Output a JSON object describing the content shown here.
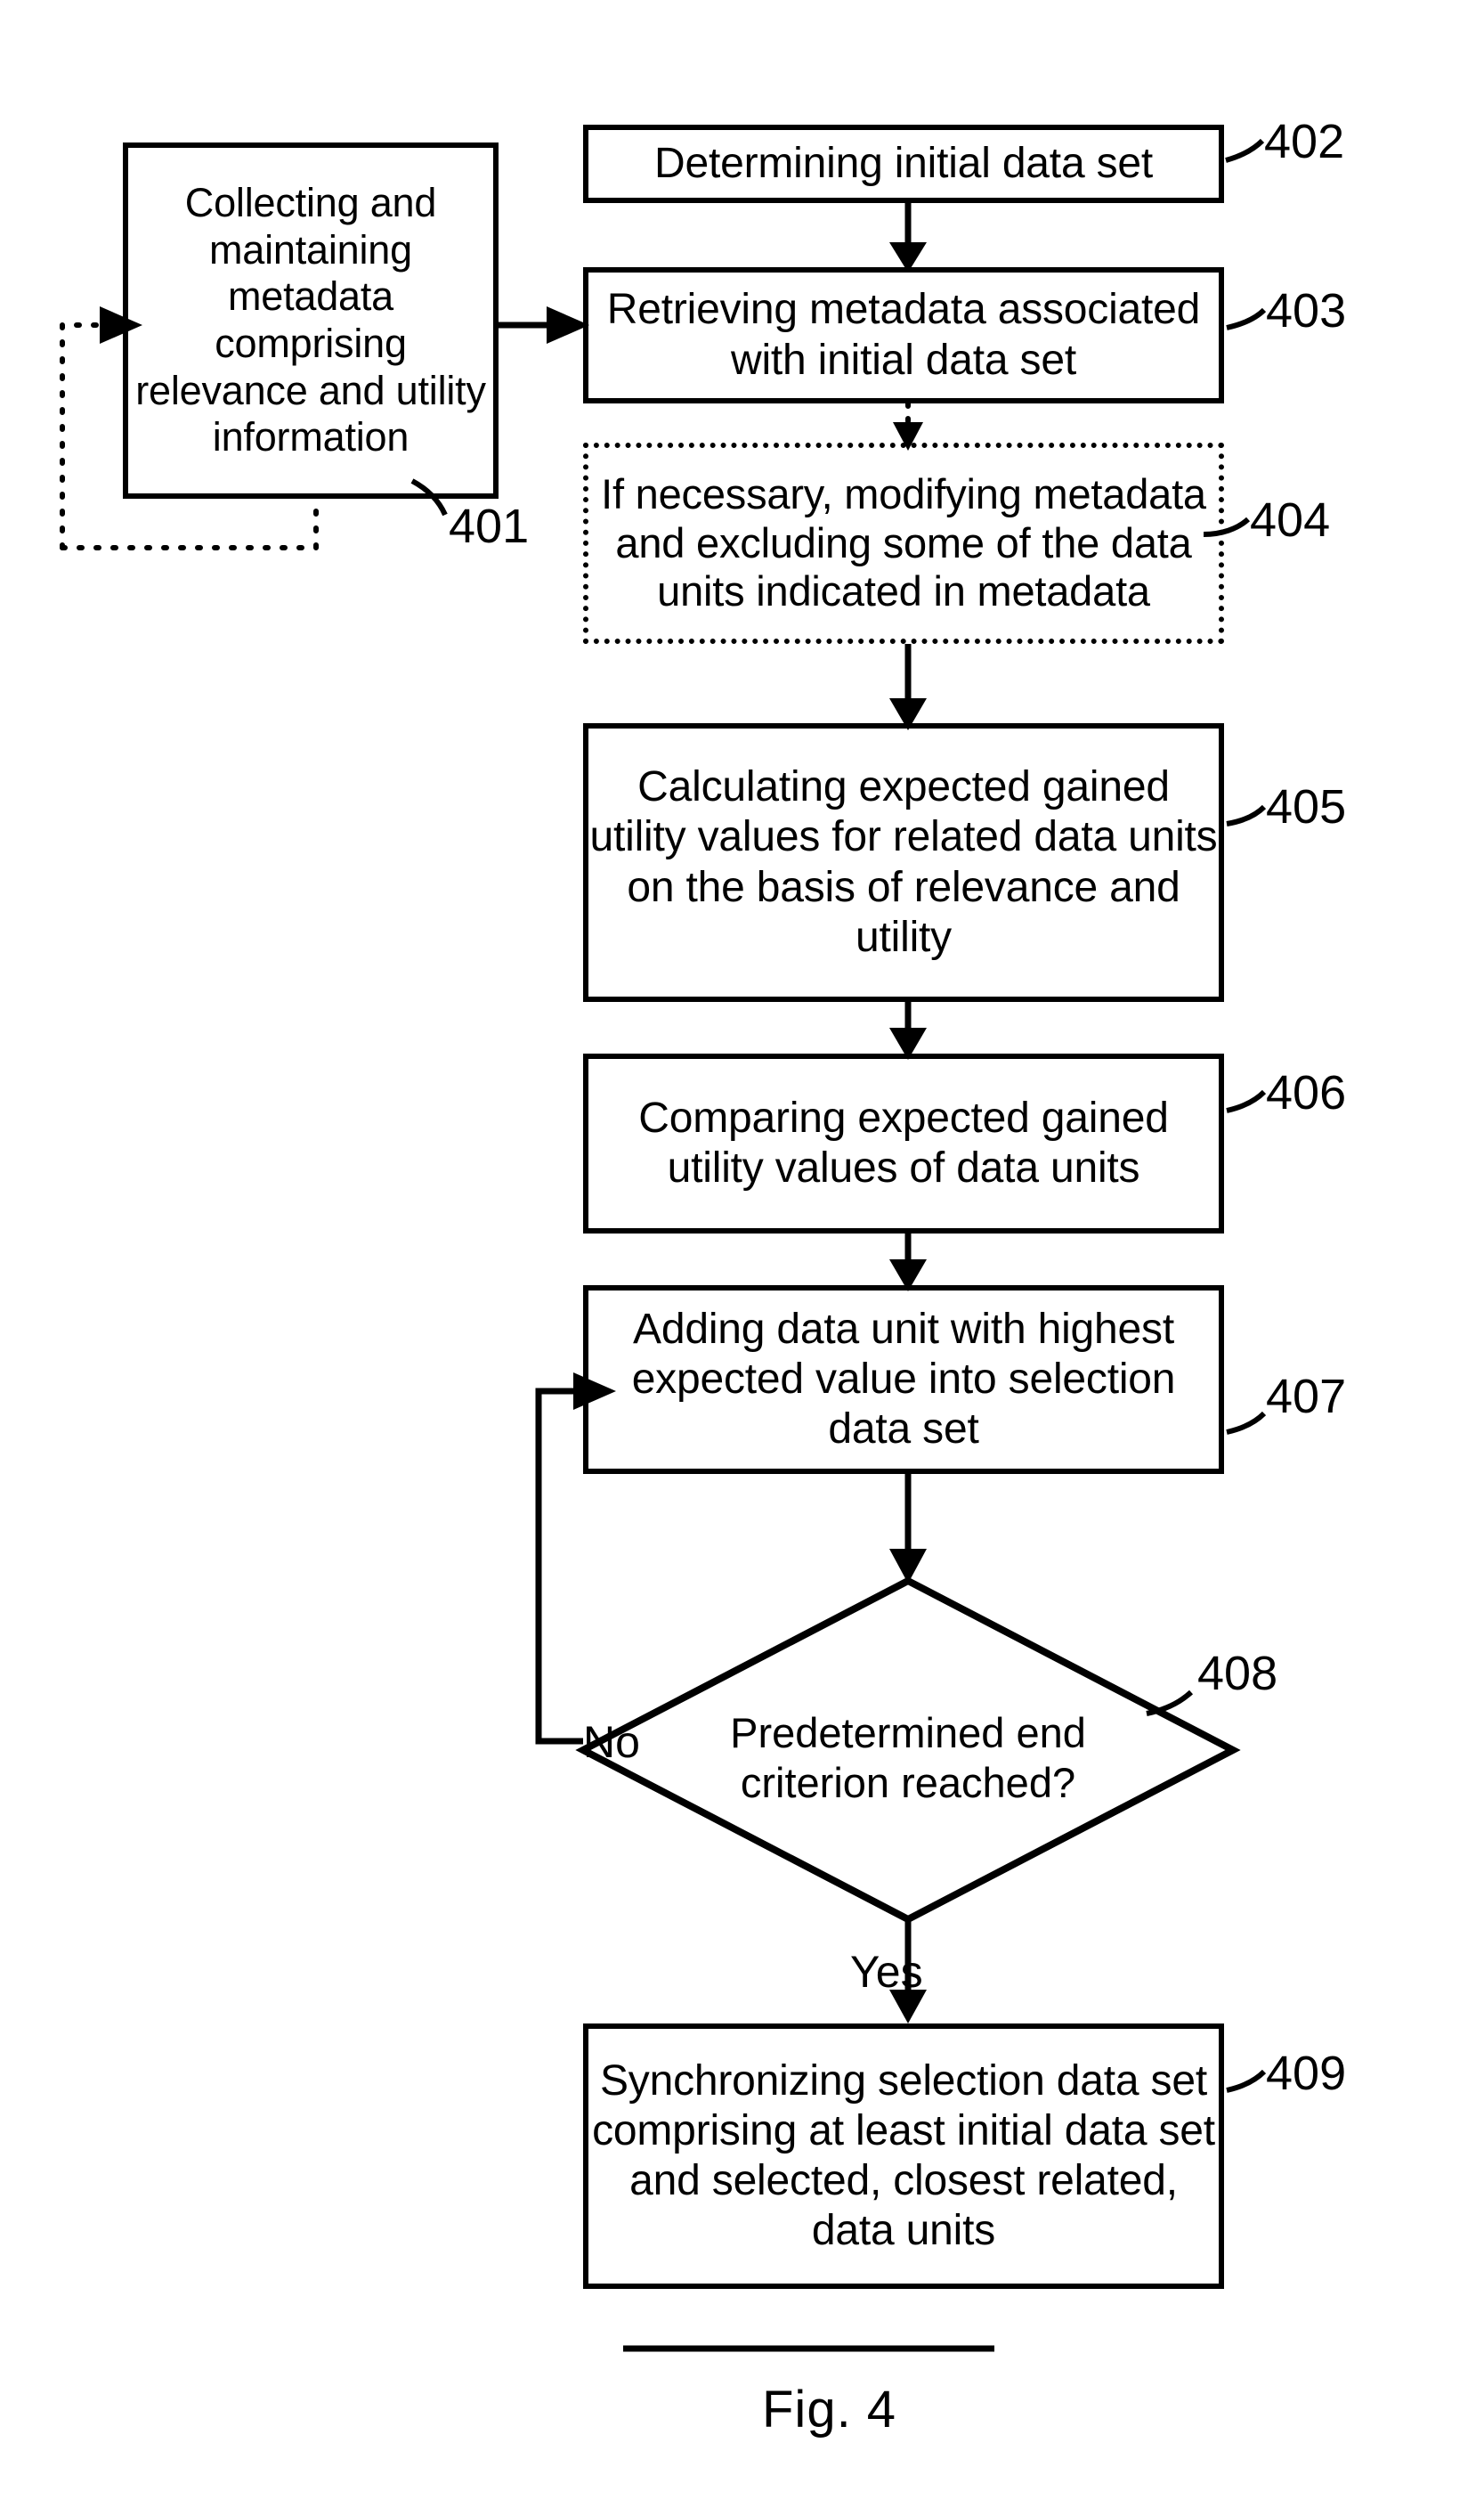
{
  "figure": {
    "caption": "Fig. 4",
    "title": "Flowchart of data selection and synchronization method"
  },
  "colors": {
    "stroke": "#000000",
    "background": "#ffffff"
  },
  "nodes": {
    "n401": {
      "ref": "401",
      "text": "Collecting and maintaining metadata comprising relevance and utility information",
      "shape": "process"
    },
    "n402": {
      "ref": "402",
      "text": "Determining initial data set",
      "shape": "process"
    },
    "n403": {
      "ref": "403",
      "text": "Retrieving metadata associated with initial data set",
      "shape": "process"
    },
    "n404": {
      "ref": "404",
      "text": "If necessary, modifying metadata and excluding some of the data units indicated in metadata",
      "shape": "process-optional-dotted"
    },
    "n405": {
      "ref": "405",
      "text": "Calculating expected gained utility values for related data units on the basis of relevance and utility",
      "shape": "process"
    },
    "n406": {
      "ref": "406",
      "text": "Comparing expected gained utility values of data units",
      "shape": "process"
    },
    "n407": {
      "ref": "407",
      "text": "Adding data unit with highest expected value into selection data set",
      "shape": "process"
    },
    "n408": {
      "ref": "408",
      "text_line1": "Predetermined end",
      "text_line2": "criterion reached?",
      "shape": "decision"
    },
    "n409": {
      "ref": "409",
      "text": "Synchronizing selection data set comprising at least initial data set and selected, closest related, data units",
      "shape": "process"
    }
  },
  "edge_labels": {
    "no": "No",
    "yes": "Yes"
  }
}
